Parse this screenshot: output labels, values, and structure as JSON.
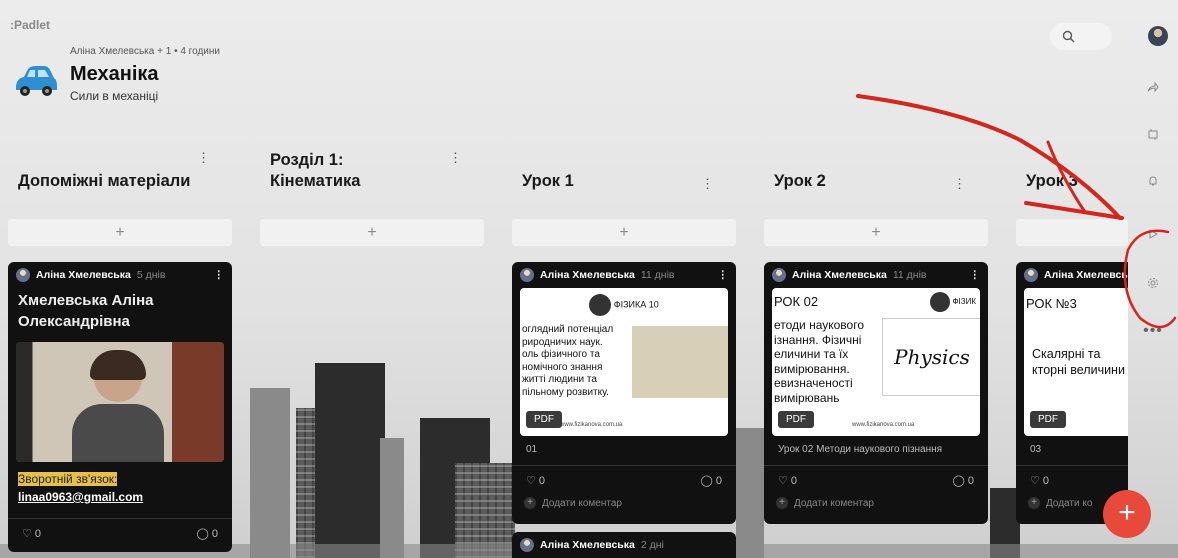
{
  "app": {
    "logo": ":Padlet"
  },
  "board": {
    "meta": "Аліна Хмелевська + 1 •  4 години",
    "title": "Механіка",
    "subtitle": "Сили в механіці"
  },
  "columns": [
    {
      "title": "Допоміжні матеріали",
      "add": "+"
    },
    {
      "title": "Розділ 1: Кінематика",
      "add": "+"
    },
    {
      "title": "Урок 1",
      "add": "+"
    },
    {
      "title": "Урок 2",
      "add": "+"
    },
    {
      "title": "Урок 3",
      "add": "+"
    }
  ],
  "cards": [
    {
      "author": "Аліна Хмелевська",
      "time": "5 днів",
      "title": "Хмелевська Аліна Олександрівна",
      "feedback_label": "Зворотній зв'язок:",
      "email": "linaa0963@gmail.com",
      "likes": "0",
      "comments": "0"
    },
    {
      "author": "Аліна Хмелевська",
      "time": "11 днів",
      "thumb_header": "ФІЗИКА 10",
      "thumb_text": "оглядний потенціал\nриродничих наук.\nоль фізичного та\nномічного знання\nжитті людини та\nпільному розвитку.",
      "thumb_footer": "www.fizikanova.com.ua",
      "badge": "PDF",
      "caption": "01",
      "likes": "0",
      "comments": "0",
      "add_comment": "Додати коментар"
    },
    {
      "author": "Аліна Хмелевська",
      "time": "11 днів",
      "thumb_header": "РОК 02",
      "thumb_header_right": "ФІЗИК",
      "thumb_text": "етоди наукового\nізнання. Фізичні\nеличини та їх\nвимірювання.\nевизначеності\nвимірювань",
      "thumb_footer": "www.fizikanova.com.ua",
      "thumb_img_text": "Physics",
      "badge": "PDF",
      "caption": "Урок 02 Методи наукового пізнання",
      "likes": "0",
      "comments": "0",
      "add_comment": "Додати коментар"
    },
    {
      "author": "Аліна Хмелевсь",
      "thumb_header": "РОК №3",
      "thumb_text": "Скалярні та\nкторні величини",
      "badge": "PDF",
      "caption": "03",
      "likes": "0",
      "add_comment": "Додати ко"
    },
    {
      "author": "Аліна Хмелевська",
      "time": "2 дні"
    }
  ],
  "icons": {
    "search": "search-icon",
    "share": "share-icon",
    "remake": "remake-icon",
    "bell": "bell-icon",
    "slideshow": "play-icon",
    "settings": "gear-icon",
    "more": "more-icon"
  },
  "colors": {
    "fab": "#e8493b",
    "annotation": "#d3261d",
    "card": "#111111",
    "highlight": "#e6c04a"
  }
}
